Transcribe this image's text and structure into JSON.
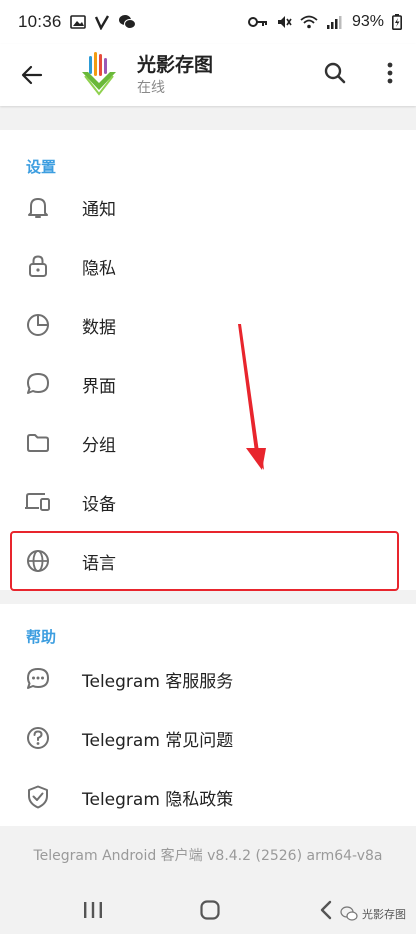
{
  "status_bar": {
    "time": "10:36",
    "battery": "93%"
  },
  "app_bar": {
    "title": "光影存图",
    "status": "在线"
  },
  "settings_section": {
    "header": "设置",
    "items": [
      {
        "label": "通知",
        "icon": "bell-icon"
      },
      {
        "label": "隐私",
        "icon": "lock-icon"
      },
      {
        "label": "数据",
        "icon": "pie-chart-icon"
      },
      {
        "label": "界面",
        "icon": "chat-bubble-icon"
      },
      {
        "label": "分组",
        "icon": "folder-icon"
      },
      {
        "label": "设备",
        "icon": "devices-icon"
      },
      {
        "label": "语言",
        "icon": "globe-icon"
      }
    ]
  },
  "help_section": {
    "header": "帮助",
    "items": [
      {
        "label": "Telegram 客服服务",
        "icon": "chat-dots-icon"
      },
      {
        "label": "Telegram 常见问题",
        "icon": "question-icon"
      },
      {
        "label": "Telegram 隐私政策",
        "icon": "shield-check-icon"
      }
    ]
  },
  "footer": {
    "version": "Telegram Android 客户端 v8.4.2 (2526) arm64-v8a"
  },
  "watermark": {
    "text": "光影存图"
  },
  "colors": {
    "accent": "#3d9ee0",
    "highlight": "#e8252d",
    "logo_green": "#6ab83a"
  }
}
